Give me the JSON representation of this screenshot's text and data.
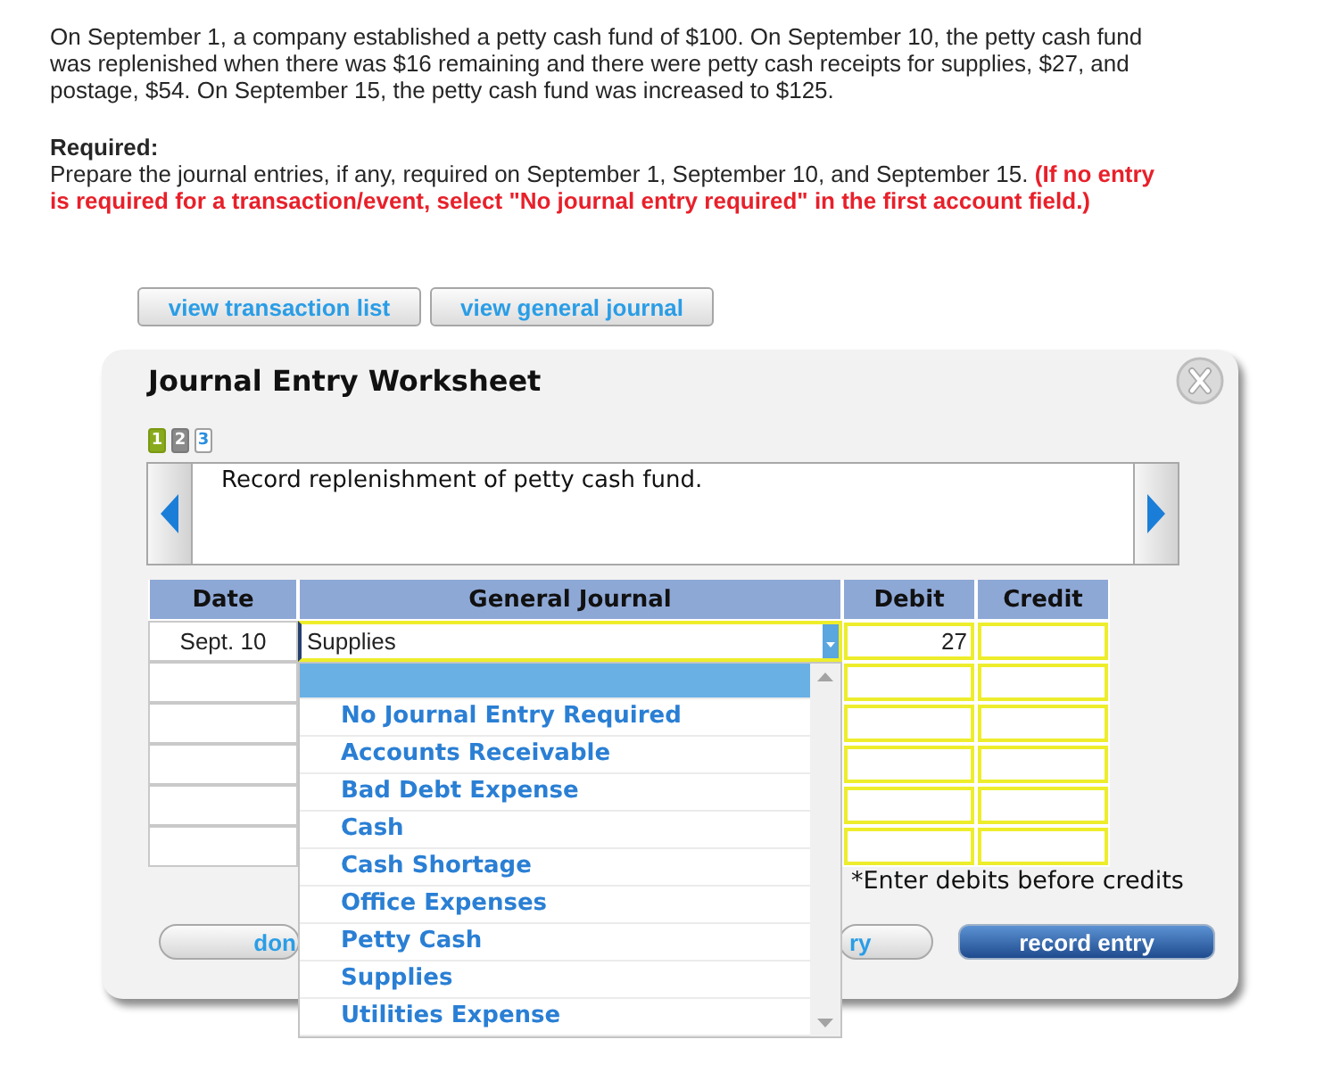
{
  "problem": {
    "text": "On September 1, a company established a petty cash fund of $100. On September 10, the petty cash fund was replenished when there was $16 remaining and there were petty cash receipts for supplies, $27, and postage, $54. On September 15, the petty cash fund was increased to $125.",
    "required_heading": "Required:",
    "required_text": "Prepare the journal entries, if any, required on September 1, September 10, and September 15. **(If no entry is required for a transaction/event, select \"No journal entry required\" in the first account field.)**"
  },
  "view_buttons": [
    {
      "label": "view transaction list"
    },
    {
      "label": "view general journal"
    }
  ],
  "worksheet": {
    "title": "Journal Entry Worksheet",
    "steps": [
      {
        "label": "1",
        "selected": false,
        "completed": true
      },
      {
        "label": "2",
        "selected": true,
        "completed": false
      },
      {
        "label": "3",
        "selected": false,
        "completed": false
      }
    ],
    "description": "Record replenishment of petty cash fund.",
    "table": {
      "columns": [
        "Date",
        "General Journal",
        "Debit",
        "Credit"
      ],
      "rows": [
        {
          "kind": "entry",
          "date": "Sept. 10",
          "account": "Supplies",
          "debit": "27"
        },
        {
          "kind": "blank"
        },
        {
          "kind": "blank"
        },
        {
          "kind": "blank"
        },
        {
          "kind": "blank"
        },
        {
          "kind": "blank"
        }
      ]
    },
    "account_dropdown": {
      "options": [
        {
          "selected": true
        },
        {
          "label": "No Journal Entry Required",
          "selected": false
        },
        {
          "label": "Accounts Receivable",
          "selected": false
        },
        {
          "label": "Bad Debt Expense",
          "selected": false
        },
        {
          "label": "Cash",
          "selected": false
        },
        {
          "label": "Cash Shortage",
          "selected": false
        },
        {
          "label": "Office Expenses",
          "selected": false
        },
        {
          "label": "Petty Cash",
          "selected": false
        },
        {
          "label": "Supplies",
          "selected": false
        },
        {
          "label": "Utilities Expense",
          "selected": false
        }
      ]
    },
    "note": "*Enter debits before credits",
    "actions": [
      {
        "label": "don",
        "kind": "secondary"
      },
      {
        "label": "ry",
        "kind": "secondary"
      },
      {
        "label": "record entry",
        "kind": "primary"
      }
    ]
  }
}
